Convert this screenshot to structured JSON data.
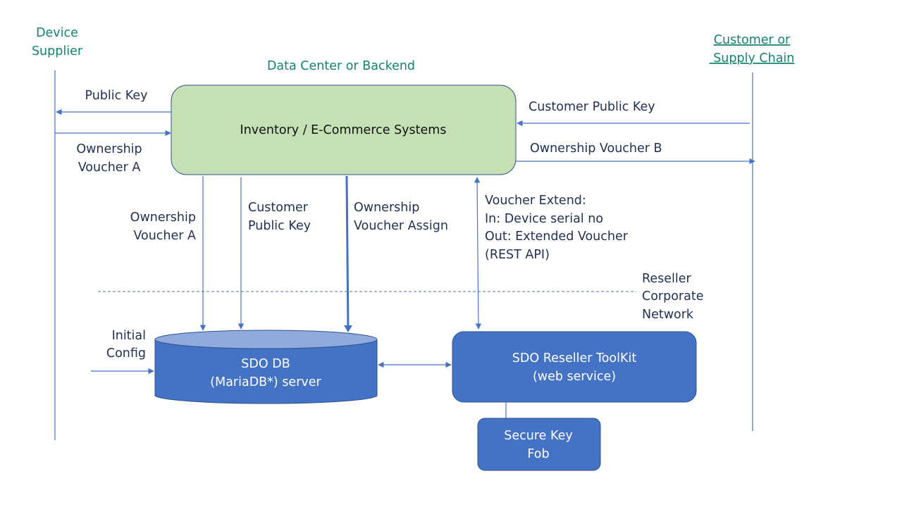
{
  "actors": {
    "device_supplier": [
      "Device",
      "Supplier"
    ],
    "customer": [
      "Customer or",
      " Supply Chain"
    ]
  },
  "zones": {
    "data_center": "Data Center or Backend",
    "reseller_network": [
      "Reseller",
      "Corporate",
      "Network"
    ]
  },
  "nodes": {
    "inventory": {
      "label": "Inventory / E-Commerce Systems",
      "fill": "#c5e0b4"
    },
    "sdo_db": {
      "label": [
        "SDO DB",
        "(MariaDB*) server"
      ],
      "fill": "#4472c4",
      "top_fill": "#8faadc"
    },
    "reseller_toolkit": {
      "label": [
        "SDO Reseller ToolKit",
        "(web service)"
      ],
      "fill": "#4472c4"
    },
    "key_fob": {
      "label": [
        "Secure Key",
        "Fob"
      ],
      "fill": "#4472c4"
    }
  },
  "flows": {
    "public_key": "Public Key",
    "ownership_voucher_a": [
      "Ownership",
      "Voucher A"
    ],
    "customer_public_key": "Customer Public Key",
    "ownership_voucher_b": "Ownership Voucher B",
    "db_voucher_a": [
      "Ownership",
      "Voucher A"
    ],
    "db_customer_key": [
      "Customer",
      "Public Key"
    ],
    "voucher_assign": [
      "Ownership",
      "Voucher Assign"
    ],
    "voucher_extend": [
      "Voucher Extend:",
      "In: Device serial no",
      "Out: Extended Voucher",
      "(REST API)"
    ],
    "initial_config": [
      "Initial",
      "Config"
    ]
  },
  "colors": {
    "line": "#4472c4",
    "actor_text": "#128372",
    "label_text": "#1f3054"
  }
}
